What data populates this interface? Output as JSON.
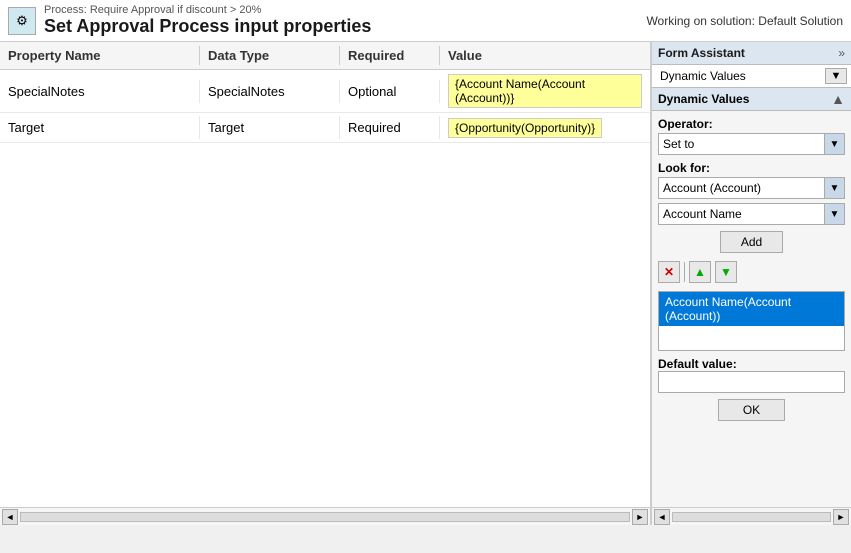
{
  "topbar": {
    "process_label": "Process: Require Approval if discount > 20%",
    "title": "Set Approval Process input properties",
    "solution_label": "Working on solution: Default Solution",
    "gear_icon": "⚙"
  },
  "table": {
    "columns": {
      "property": "Property Name",
      "datatype": "Data Type",
      "required": "Required",
      "value": "Value"
    },
    "rows": [
      {
        "property": "SpecialNotes",
        "datatype": "SpecialNotes",
        "required": "Optional",
        "value": "{Account Name(Account (Account))}"
      },
      {
        "property": "Target",
        "datatype": "Target",
        "required": "Required",
        "value": "{Opportunity(Opportunity)}"
      }
    ]
  },
  "form_assistant": {
    "title": "Form Assistant",
    "chevron": "»",
    "dynamic_values_label": "Dynamic Values",
    "dynamic_values_section": "Dynamic Values",
    "operator_label": "Operator:",
    "operator_value": "Set to",
    "look_for_label": "Look for:",
    "look_for_value": "Account (Account)",
    "field_value": "Account Name",
    "add_label": "Add",
    "list_selected": "Account Name(Account (Account))",
    "default_value_label": "Default value:",
    "default_value_placeholder": "",
    "ok_label": "OK"
  },
  "scrollbar": {
    "left_arrow": "◄",
    "right_arrow": "►"
  }
}
